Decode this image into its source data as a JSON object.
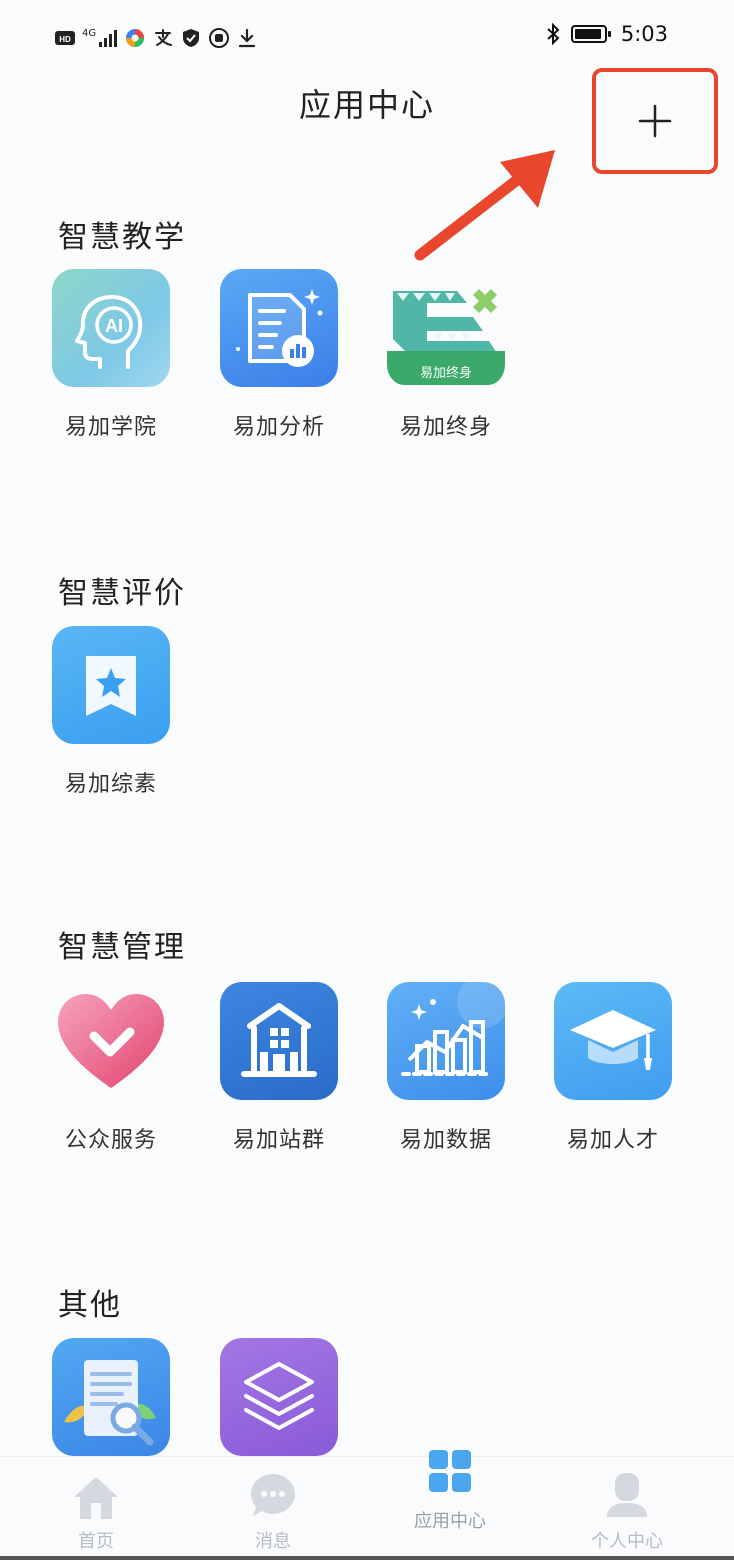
{
  "status_bar": {
    "network_text": "4G",
    "time": "5:03"
  },
  "header": {
    "title": "应用中心"
  },
  "sections": [
    {
      "title": "智慧教学",
      "apps": [
        {
          "label": "易加学院",
          "icon": "ai-head-icon"
        },
        {
          "label": "易加分析",
          "icon": "report-chart-icon"
        },
        {
          "label": "易加终身",
          "icon": "lifelong-logo-icon",
          "icon_text": "易加终身"
        }
      ]
    },
    {
      "title": "智慧评价",
      "apps": [
        {
          "label": "易加综素",
          "icon": "star-bookmark-icon"
        }
      ]
    },
    {
      "title": "智慧管理",
      "apps": [
        {
          "label": "公众服务",
          "icon": "heart-check-icon"
        },
        {
          "label": "易加站群",
          "icon": "building-icon"
        },
        {
          "label": "易加数据",
          "icon": "bar-chart-icon"
        },
        {
          "label": "易加人才",
          "icon": "graduation-cap-icon"
        }
      ]
    },
    {
      "title": "其他",
      "apps": [
        {
          "label": "",
          "icon": "document-search-icon"
        },
        {
          "label": "",
          "icon": "layers-icon"
        }
      ]
    }
  ],
  "tab_bar": {
    "tabs": [
      {
        "label": "首页",
        "icon": "home-icon",
        "active": false
      },
      {
        "label": "消息",
        "icon": "message-icon",
        "active": false
      },
      {
        "label": "应用中心",
        "icon": "grid-icon",
        "active": true
      },
      {
        "label": "个人中心",
        "icon": "user-icon",
        "active": false
      }
    ]
  },
  "colors": {
    "annotation_red": "#e8472d",
    "active_tab_blue": "#4aa6ee",
    "inactive_tab_gray": "#d5d9df"
  }
}
